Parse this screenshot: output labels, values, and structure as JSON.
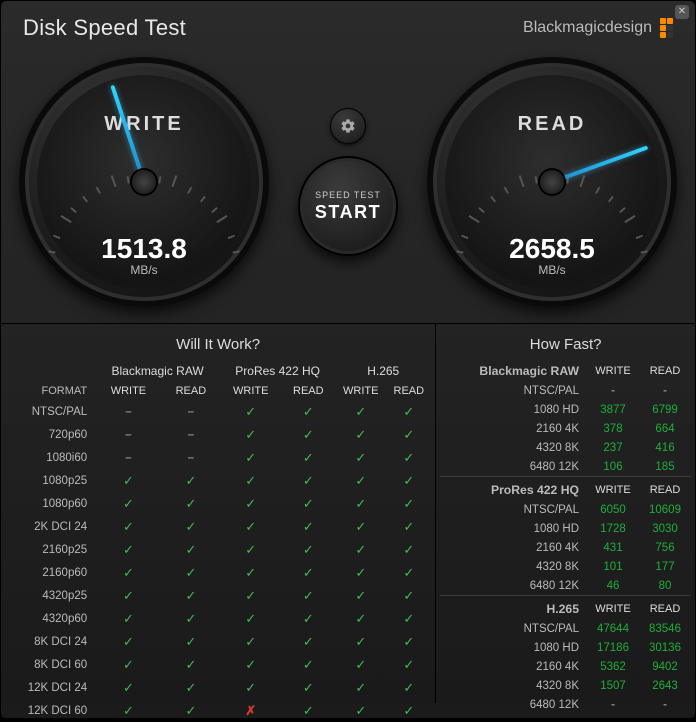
{
  "app": {
    "title": "Disk Speed Test",
    "brand": "Blackmagicdesign"
  },
  "gauges": {
    "write": {
      "label": "WRITE",
      "value": "1513.8",
      "unit": "MB/s"
    },
    "read": {
      "label": "READ",
      "value": "2658.5",
      "unit": "MB/s"
    }
  },
  "start_button": {
    "small": "SPEED TEST",
    "large": "START"
  },
  "will_it_work": {
    "heading": "Will It Work?",
    "format_header": "FORMAT",
    "groups": [
      "Blackmagic RAW",
      "ProRes 422 HQ",
      "H.265"
    ],
    "subheaders": [
      "WRITE",
      "READ"
    ],
    "rows": [
      {
        "format": "NTSC/PAL",
        "cells": [
          "dash",
          "dash",
          "check",
          "check",
          "check",
          "check"
        ]
      },
      {
        "format": "720p60",
        "cells": [
          "dash",
          "dash",
          "check",
          "check",
          "check",
          "check"
        ]
      },
      {
        "format": "1080i60",
        "cells": [
          "dash",
          "dash",
          "check",
          "check",
          "check",
          "check"
        ]
      },
      {
        "format": "1080p25",
        "cells": [
          "check",
          "check",
          "check",
          "check",
          "check",
          "check"
        ]
      },
      {
        "format": "1080p60",
        "cells": [
          "check",
          "check",
          "check",
          "check",
          "check",
          "check"
        ]
      },
      {
        "format": "2K DCI 24",
        "cells": [
          "check",
          "check",
          "check",
          "check",
          "check",
          "check"
        ]
      },
      {
        "format": "2160p25",
        "cells": [
          "check",
          "check",
          "check",
          "check",
          "check",
          "check"
        ]
      },
      {
        "format": "2160p60",
        "cells": [
          "check",
          "check",
          "check",
          "check",
          "check",
          "check"
        ]
      },
      {
        "format": "4320p25",
        "cells": [
          "check",
          "check",
          "check",
          "check",
          "check",
          "check"
        ]
      },
      {
        "format": "4320p60",
        "cells": [
          "check",
          "check",
          "check",
          "check",
          "check",
          "check"
        ]
      },
      {
        "format": "8K DCI 24",
        "cells": [
          "check",
          "check",
          "check",
          "check",
          "check",
          "check"
        ]
      },
      {
        "format": "8K DCI 60",
        "cells": [
          "check",
          "check",
          "check",
          "check",
          "check",
          "check"
        ]
      },
      {
        "format": "12K DCI 24",
        "cells": [
          "check",
          "check",
          "check",
          "check",
          "check",
          "check"
        ]
      },
      {
        "format": "12K DCI 60",
        "cells": [
          "check",
          "check",
          "x",
          "check",
          "check",
          "check"
        ]
      }
    ]
  },
  "how_fast": {
    "heading": "How Fast?",
    "subheaders": [
      "WRITE",
      "READ"
    ],
    "sections": [
      {
        "name": "Blackmagic RAW",
        "rows": [
          {
            "label": "NTSC/PAL",
            "write": "-",
            "read": "-"
          },
          {
            "label": "1080 HD",
            "write": "3877",
            "read": "6799"
          },
          {
            "label": "2160 4K",
            "write": "378",
            "read": "664"
          },
          {
            "label": "4320 8K",
            "write": "237",
            "read": "416"
          },
          {
            "label": "6480 12K",
            "write": "106",
            "read": "185"
          }
        ]
      },
      {
        "name": "ProRes 422 HQ",
        "rows": [
          {
            "label": "NTSC/PAL",
            "write": "6050",
            "read": "10609"
          },
          {
            "label": "1080 HD",
            "write": "1728",
            "read": "3030"
          },
          {
            "label": "2160 4K",
            "write": "431",
            "read": "756"
          },
          {
            "label": "4320 8K",
            "write": "101",
            "read": "177"
          },
          {
            "label": "6480 12K",
            "write": "46",
            "read": "80"
          }
        ]
      },
      {
        "name": "H.265",
        "rows": [
          {
            "label": "NTSC/PAL",
            "write": "47644",
            "read": "83546"
          },
          {
            "label": "1080 HD",
            "write": "17186",
            "read": "30136"
          },
          {
            "label": "2160 4K",
            "write": "5362",
            "read": "9402"
          },
          {
            "label": "4320 8K",
            "write": "1507",
            "read": "2643"
          },
          {
            "label": "6480 12K",
            "write": "-",
            "read": "-"
          }
        ]
      }
    ]
  },
  "chart_data": [
    {
      "type": "gauge",
      "title": "WRITE",
      "value": 1513.8,
      "unit": "MB/s",
      "range": [
        0,
        3500
      ],
      "redline_from": 3000
    },
    {
      "type": "gauge",
      "title": "READ",
      "value": 2658.5,
      "unit": "MB/s",
      "range": [
        0,
        3500
      ],
      "redline_from": 3000
    }
  ]
}
